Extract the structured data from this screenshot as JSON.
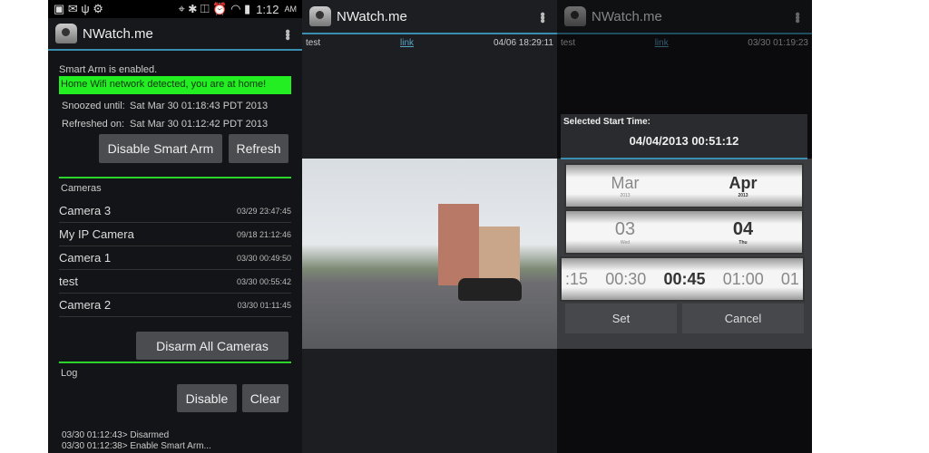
{
  "status": {
    "time": "1:12",
    "ampm": "AM"
  },
  "app_title": "NWatch.me",
  "panel1": {
    "smart_arm": "Smart Arm is enabled.",
    "wifi_notice": "Home Wifi network detected, you are at home!",
    "snoozed_label": "Snoozed until:",
    "snoozed_value": "Sat Mar 30 01:18:43 PDT 2013",
    "refreshed_label": "Refreshed on:",
    "refreshed_value": "Sat Mar 30 01:12:42 PDT 2013",
    "disable_smart_arm": "Disable Smart Arm",
    "refresh": "Refresh",
    "cameras_header": "Cameras",
    "cameras": [
      {
        "name": "Camera 3",
        "time": "03/29 23:47:45"
      },
      {
        "name": "My IP Camera",
        "time": "09/18 21:12:46"
      },
      {
        "name": "Camera 1",
        "time": "03/30 00:49:50"
      },
      {
        "name": "test",
        "time": "03/30 00:55:42"
      },
      {
        "name": "Camera 2",
        "time": "03/30 01:11:45"
      }
    ],
    "disarm_all": "Disarm All Cameras",
    "log_header": "Log",
    "disable": "Disable",
    "clear": "Clear",
    "log": [
      "03/30 01:12:43> Disarmed",
      "03/30 01:12:38> Enable Smart Arm..."
    ]
  },
  "panel2": {
    "camera": "test",
    "link": "link",
    "time": "04/06 18:29:11"
  },
  "panel3": {
    "camera": "test",
    "link": "link",
    "time": "03/30 01:19:23",
    "dialog_title": "Selected Start Time:",
    "dialog_value": "04/04/2013 00:51:12",
    "months": [
      "Mar",
      "Apr"
    ],
    "month_years": [
      "2013",
      "2013"
    ],
    "days": [
      "03",
      "04"
    ],
    "day_names": [
      "Wed",
      "Thu"
    ],
    "times": [
      ":15",
      "00:30",
      "00:45",
      "01:00",
      "01"
    ],
    "set": "Set",
    "cancel": "Cancel"
  },
  "colors": {
    "accent": "#3a8fb0",
    "notice": "#2bd42b"
  }
}
